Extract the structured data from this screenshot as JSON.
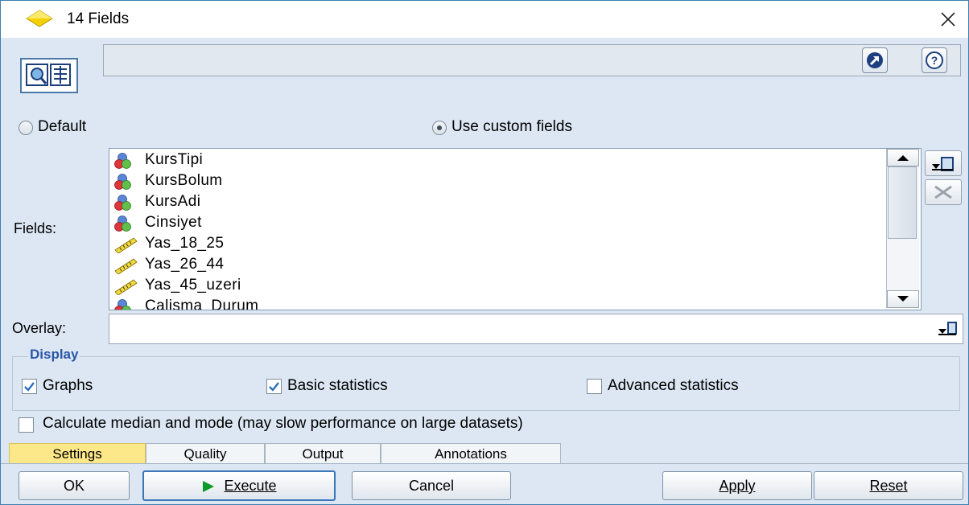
{
  "window": {
    "title": "14 Fields"
  },
  "mode": {
    "default_label": "Default",
    "custom_label": "Use custom fields",
    "selected": "custom"
  },
  "fields": {
    "label": "Fields:",
    "items": [
      {
        "name": "KursTipi",
        "type": "nominal"
      },
      {
        "name": "KursBolum",
        "type": "nominal"
      },
      {
        "name": "KursAdi",
        "type": "nominal"
      },
      {
        "name": "Cinsiyet",
        "type": "nominal"
      },
      {
        "name": "Yas_18_25",
        "type": "continuous"
      },
      {
        "name": "Yas_26_44",
        "type": "continuous"
      },
      {
        "name": "Yas_45_uzeri",
        "type": "continuous"
      },
      {
        "name": "Calisma_Durum",
        "type": "nominal"
      }
    ]
  },
  "overlay": {
    "label": "Overlay:",
    "value": ""
  },
  "display": {
    "title": "Display",
    "graphs_label": "Graphs",
    "graphs_checked": true,
    "basic_label": "Basic statistics",
    "basic_checked": true,
    "advanced_label": "Advanced statistics",
    "advanced_checked": false
  },
  "median": {
    "label": "Calculate median and mode (may slow performance on large datasets)",
    "checked": false
  },
  "tabs": [
    {
      "label": "Settings",
      "active": true
    },
    {
      "label": "Quality",
      "active": false
    },
    {
      "label": "Output",
      "active": false
    },
    {
      "label": "Annotations",
      "active": false
    }
  ],
  "buttons": {
    "ok": "OK",
    "execute": "Execute",
    "cancel": "Cancel",
    "apply": "Apply",
    "reset": "Reset"
  },
  "icons": {
    "title": "diamond-node-icon",
    "tool": "data-audit-icon",
    "launch": "launch-icon",
    "help": "help-icon",
    "field_picker": "field-picker-icon",
    "delete": "delete-icon"
  },
  "colors": {
    "accent": "#2a55a8",
    "active_tab": "#fde889",
    "diamond": "#f4d000"
  }
}
